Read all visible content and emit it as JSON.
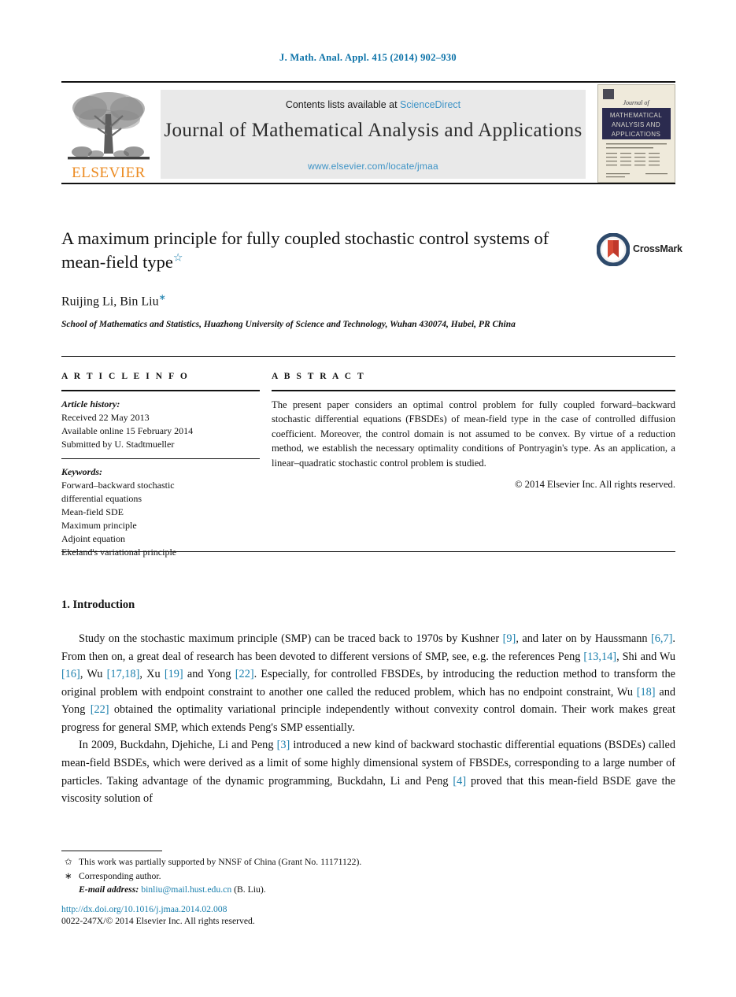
{
  "running_head": "J. Math. Anal. Appl. 415 (2014) 902–930",
  "masthead": {
    "publisher_wordmark": "ELSEVIER",
    "contents_prefix": "Contents lists available at",
    "contents_link": "ScienceDirect",
    "journal_name": "Journal of Mathematical Analysis and Applications",
    "journal_url": "www.elsevier.com/locate/jmaa",
    "cover": {
      "line1": "Journal of",
      "line2": "MATHEMATICAL",
      "line3": "ANALYSIS AND",
      "line4": "APPLICATIONS"
    },
    "colors": {
      "link_blue": "#3d93c6",
      "elsevier_orange": "#ec8b22",
      "band_gray": "#e9e9e9",
      "cover_navy": "#2b2b4f",
      "cover_cream": "#efeadb"
    }
  },
  "article": {
    "title": "A maximum principle for fully coupled stochastic control systems of mean-field type",
    "title_footnote_mark": "☆",
    "authors": "Ruijing Li, Bin Liu",
    "corresponding_mark": "∗",
    "affiliation": "School of Mathematics and Statistics, Huazhong University of Science and Technology, Wuhan 430074, Hubei, PR China",
    "crossmark_label": "CrossMark"
  },
  "info": {
    "heading": "A R T I C L E    I N F O",
    "history_label": "Article history:",
    "history": [
      "Received 22 May 2013",
      "Available online 15 February 2014",
      "Submitted by U. Stadtmueller"
    ],
    "keywords_label": "Keywords:",
    "keywords": [
      "Forward–backward stochastic",
      "differential equations",
      "Mean-field SDE",
      "Maximum principle",
      "Adjoint equation",
      "Ekeland's variational principle"
    ]
  },
  "abstract": {
    "heading": "A B S T R A C T",
    "text": "The present paper considers an optimal control problem for fully coupled forward–backward stochastic differential equations (FBSDEs) of mean-field type in the case of controlled diffusion coefficient. Moreover, the control domain is not assumed to be convex. By virtue of a reduction method, we establish the necessary optimality conditions of Pontryagin's type. As an application, a linear–quadratic stochastic control problem is studied.",
    "copyright": "© 2014 Elsevier Inc. All rights reserved."
  },
  "body": {
    "section_number_title": "1. Introduction",
    "paragraph1_parts": [
      "Study on the stochastic maximum principle (SMP) can be traced back to 1970s by Kushner ",
      "[9]",
      ", and later on by Haussmann ",
      "[6,7]",
      ". From then on, a great deal of research has been devoted to different versions of SMP, see, e.g. the references Peng ",
      "[13,14]",
      ", Shi and Wu ",
      "[16]",
      ", Wu ",
      "[17,18]",
      ", Xu ",
      "[19]",
      " and Yong ",
      "[22]",
      ". Especially, for controlled FBSDEs, by introducing the reduction method to transform the original problem with endpoint constraint to another one called the reduced problem, which has no endpoint constraint, Wu ",
      "[18]",
      " and Yong ",
      "[22]",
      " obtained the optimality variational principle independently without convexity control domain. Their work makes great progress for general SMP, which extends Peng's SMP essentially."
    ],
    "paragraph2_parts": [
      "In 2009, Buckdahn, Djehiche, Li and Peng ",
      "[3]",
      " introduced a new kind of backward stochastic differential equations (BSDEs) called mean-field BSDEs, which were derived as a limit of some highly dimensional system of FBSDEs, corresponding to a large number of particles. Taking advantage of the dynamic programming, Buckdahn, Li and Peng ",
      "[4]",
      " proved that this mean-field BSDE gave the viscosity solution of"
    ]
  },
  "footnotes": {
    "star_mark": "✩",
    "star_text": "This work was partially supported by NNSF of China (Grant No. 11171122).",
    "corr_mark": "∗",
    "corr_text": "Corresponding author.",
    "email_label": "E-mail address:",
    "email": "binliu@mail.hust.edu.cn",
    "email_suffix": "(B. Liu)."
  },
  "footer": {
    "doi": "http://dx.doi.org/10.1016/j.jmaa.2014.02.008",
    "issn_line": "0022-247X/© 2014 Elsevier Inc. All rights reserved."
  }
}
